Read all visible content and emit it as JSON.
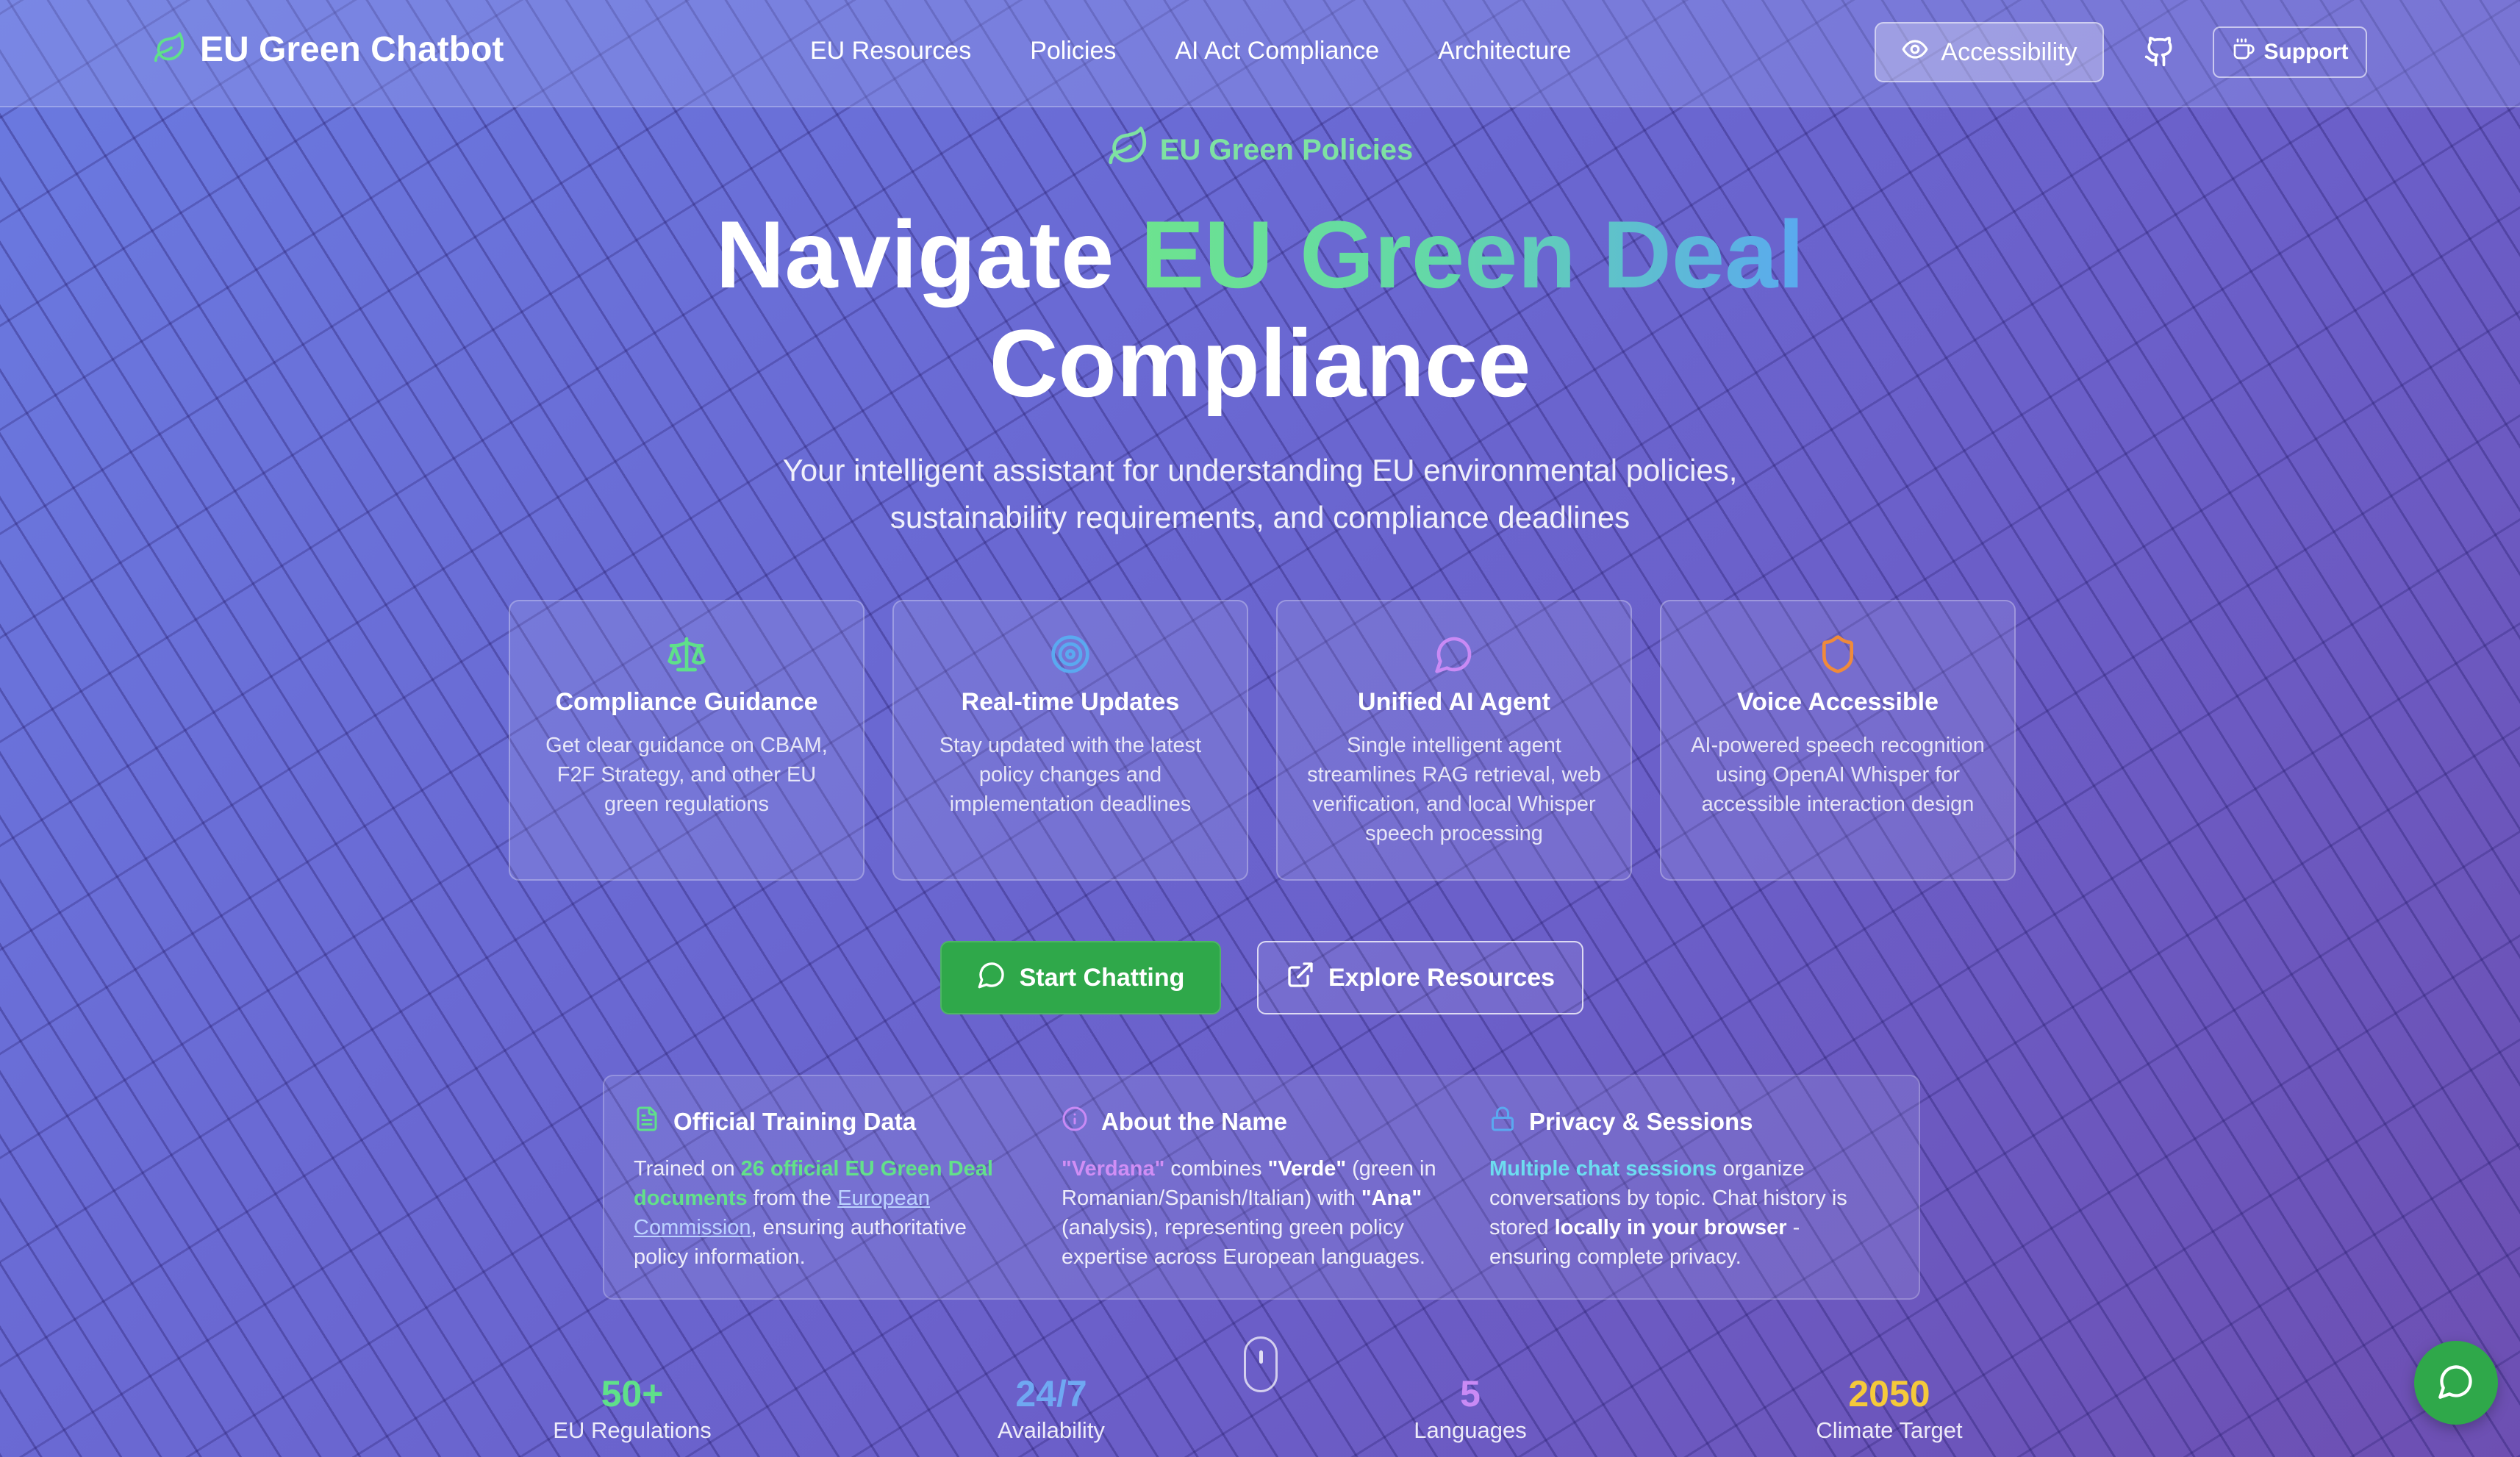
{
  "nav": {
    "brand": "EU Green Chatbot",
    "links": [
      "EU Resources",
      "Policies",
      "AI Act Compliance",
      "Architecture"
    ],
    "accessibility_label": "Accessibility",
    "support_label": "Support"
  },
  "hero": {
    "eyebrow": "EU Green Policies",
    "title_plain": "Navigate ",
    "title_highlight": "EU Green Deal",
    "title_line2": "Compliance",
    "subtitle_line1": "Your intelligent assistant for understanding EU environmental policies,",
    "subtitle_line2": "sustainability requirements, and compliance deadlines"
  },
  "features": [
    {
      "icon": "scale-icon",
      "title": "Compliance Guidance",
      "desc": "Get clear guidance on CBAM, F2F Strategy, and other EU green regulations"
    },
    {
      "icon": "target-icon",
      "title": "Real-time Updates",
      "desc": "Stay updated with the latest policy changes and implementation deadlines"
    },
    {
      "icon": "chat-bubble-icon",
      "title": "Unified AI Agent",
      "desc": "Single intelligent agent streamlines RAG retrieval, web verification, and local Whisper speech processing"
    },
    {
      "icon": "shield-icon",
      "title": "Voice Accessible",
      "desc": "AI-powered speech recognition using OpenAI Whisper for accessible interaction design"
    }
  ],
  "cta": {
    "start": "Start Chatting",
    "explore": "Explore Resources"
  },
  "info": {
    "training": {
      "title": "Official Training Data",
      "p1": "Trained on ",
      "highlight": "26 official EU Green Deal documents",
      "p2": " from the ",
      "link": "European Commission",
      "p3": ", ensuring authoritative policy information."
    },
    "name": {
      "title": "About the Name",
      "verdana": "\"Verdana\"",
      "p1": " combines ",
      "verde": "\"Verde\"",
      "p2": " (green in Romanian/Spanish/Italian) with ",
      "ana": "\"Ana\"",
      "p3": " (analysis), representing green policy expertise across European languages."
    },
    "privacy": {
      "title": "Privacy & Sessions",
      "highlight": "Multiple chat sessions",
      "p1": " organize conversations by topic. Chat history is stored ",
      "bold": "locally in your browser",
      "p2": " - ensuring complete privacy."
    }
  },
  "stats": [
    {
      "value": "50+",
      "label": "EU Regulations",
      "color": "#5fe08a"
    },
    {
      "value": "24/7",
      "label": "Availability",
      "color": "#6fa8f2"
    },
    {
      "value": "5",
      "label": "Languages",
      "color": "#c98af5"
    },
    {
      "value": "2050",
      "label": "Climate Target",
      "color": "#f5c93a"
    }
  ],
  "colors": {
    "green_accent": "#2fa84a",
    "leaf_green": "#5fe08a"
  }
}
